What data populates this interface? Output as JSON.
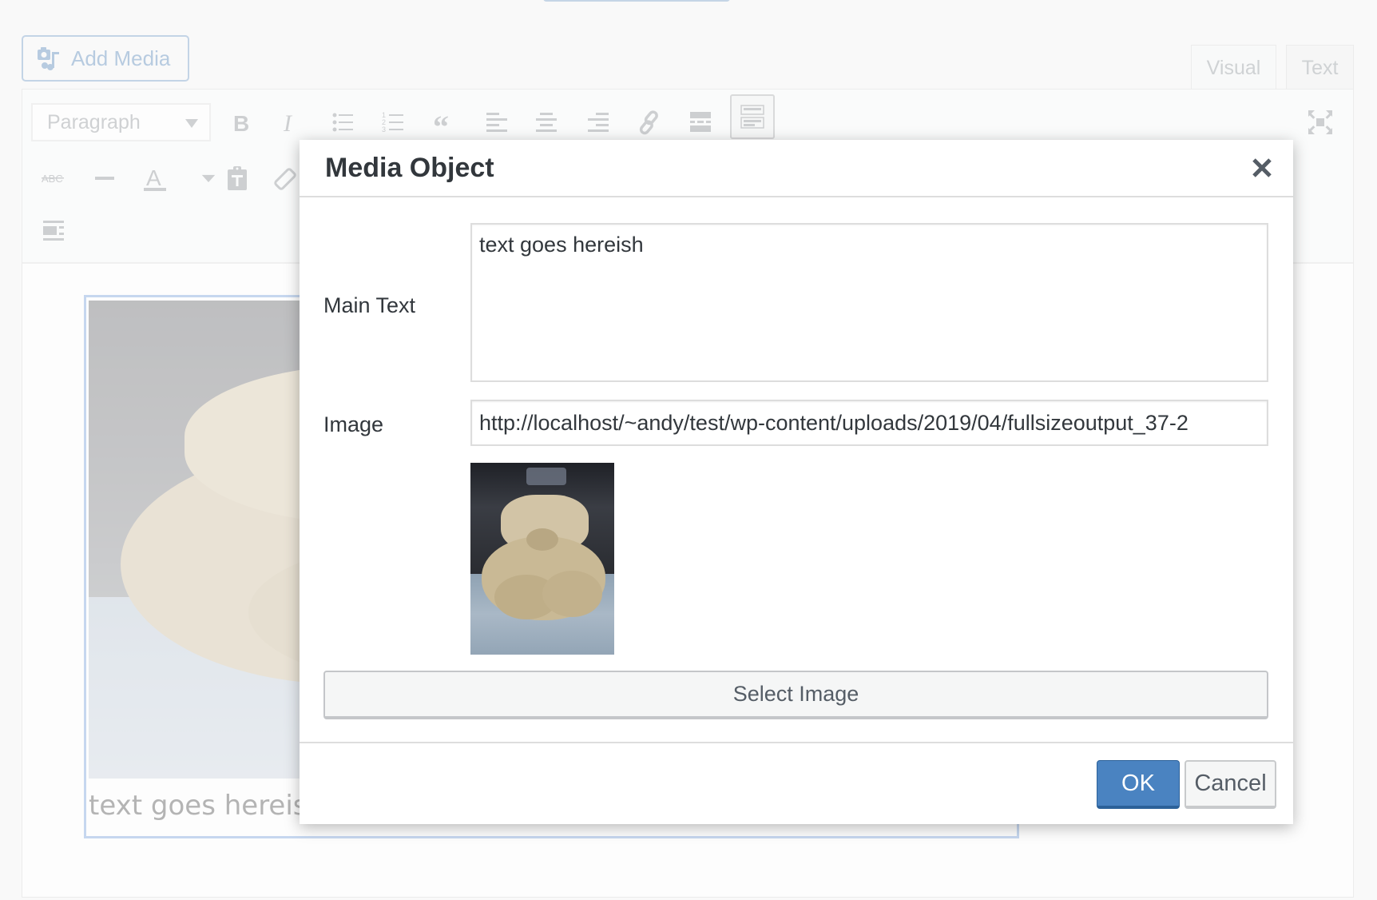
{
  "editor": {
    "add_media_label": "Add Media",
    "tabs": [
      {
        "label": "Visual",
        "active": true
      },
      {
        "label": "Text",
        "active": false
      }
    ],
    "format_select": {
      "value": "Paragraph"
    },
    "toolbar_row1": [
      "bold-icon",
      "italic-icon",
      "bulleted-list-icon",
      "numbered-list-icon",
      "blockquote-icon",
      "align-left-icon",
      "align-center-icon",
      "align-right-icon",
      "link-icon",
      "read-more-icon",
      "toolbar-toggle-icon"
    ],
    "toolbar_row2": [
      "strikethrough-icon",
      "horizontal-line-icon",
      "text-color-icon",
      "paste-as-text-icon",
      "clear-formatting-icon"
    ],
    "toolbar_row3": [
      "media-object-icon"
    ],
    "fullscreen_icon": "fullscreen-icon",
    "media_block": {
      "caption": "text goes hereish"
    }
  },
  "dialog": {
    "title": "Media Object",
    "close_icon": "close-icon",
    "fields": {
      "main_text": {
        "label": "Main Text",
        "value": "text goes hereish"
      },
      "image": {
        "label": "Image",
        "value": "http://localhost/~andy/test/wp-content/uploads/2019/04/fullsizeoutput_37-2"
      }
    },
    "select_image_label": "Select Image",
    "ok_label": "OK",
    "cancel_label": "Cancel"
  },
  "colors": {
    "primary_button": "#4a83c1",
    "primary_button_border": "#2c6199",
    "dialog_text": "#32373c",
    "selection_outline": "#c6d7ef"
  }
}
